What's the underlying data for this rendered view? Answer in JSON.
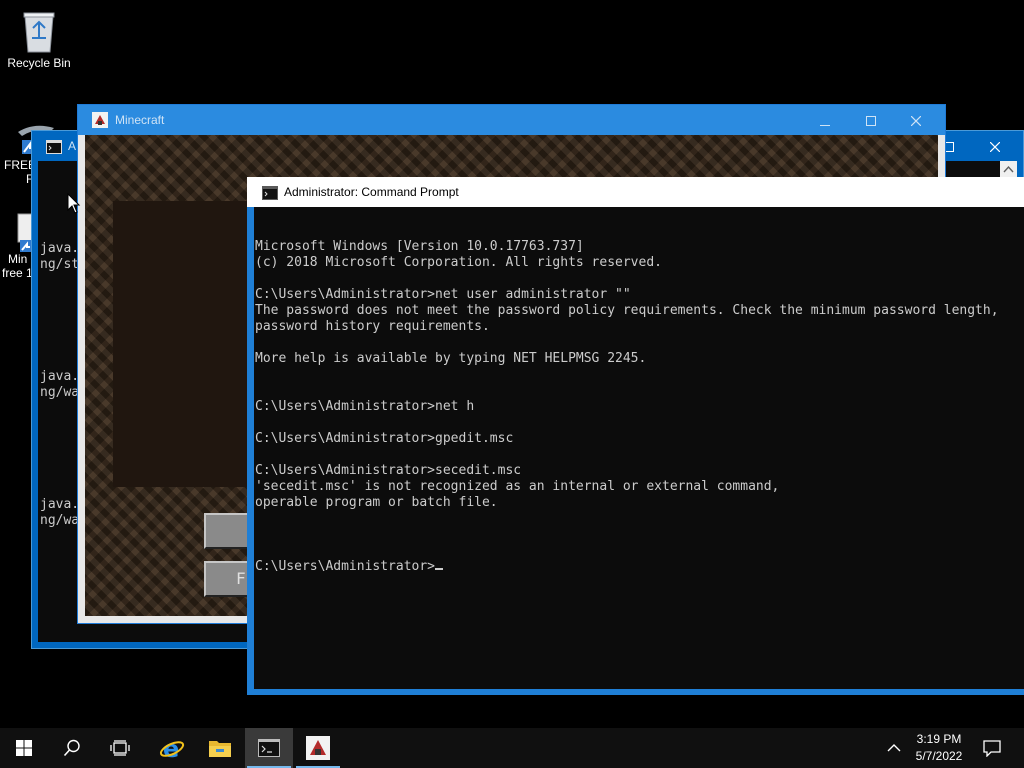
{
  "desktop": {
    "recycle_bin_label": "Recycle Bin",
    "icon2_label_line1": "FREE",
    "icon2_label_line2": "F",
    "icon3_label_line1": "Min",
    "icon3_label_line2": "free 1"
  },
  "back_cmd": {
    "title": "A",
    "lines": [
      "java.",
      "ng/st",
      "",
      "",
      "",
      "",
      "",
      "",
      "java.",
      "ng/wa",
      "",
      "",
      "",
      "",
      "",
      "",
      "java.",
      "ng/wa"
    ]
  },
  "minecraft": {
    "title": "Minecraft",
    "button2_label": "F"
  },
  "cmd": {
    "title": "Administrator: Command Prompt",
    "lines": [
      "Microsoft Windows [Version 10.0.17763.737]",
      "(c) 2018 Microsoft Corporation. All rights reserved.",
      "",
      "C:\\Users\\Administrator>net user administrator \"\"",
      "The password does not meet the password policy requirements. Check the minimum password length,",
      "password history requirements.",
      "",
      "More help is available by typing NET HELPMSG 2245.",
      "",
      "",
      "C:\\Users\\Administrator>net h",
      "",
      "C:\\Users\\Administrator>gpedit.msc",
      "",
      "C:\\Users\\Administrator>secedit.msc",
      "'secedit.msc' is not recognized as an internal or external command,",
      "operable program or batch file.",
      ""
    ],
    "prompt": "C:\\Users\\Administrator>"
  },
  "taskbar": {
    "time": "3:19 PM",
    "date": "5/7/2022",
    "icons": [
      "windows-start-icon",
      "search-icon",
      "task-view-icon",
      "internet-explorer-icon",
      "file-explorer-icon",
      "command-prompt-icon",
      "minecraft-launcher-icon",
      "chevron-up-icon",
      "notifications-icon"
    ]
  },
  "colors": {
    "titlebar_active": "#0078d7",
    "console_bg": "#0c0c0c",
    "console_fg": "#cccccc",
    "taskbar_bg": "#101010"
  }
}
